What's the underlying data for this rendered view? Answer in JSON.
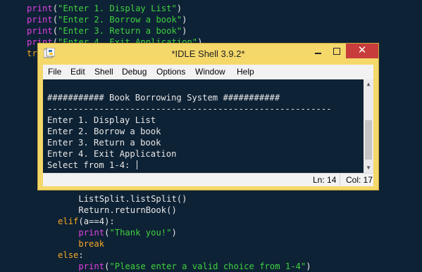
{
  "editor": {
    "top_lines": [
      {
        "parts": [
          {
            "t": "print",
            "c": "kw-print"
          },
          {
            "t": "(",
            "c": "plain"
          },
          {
            "t": "\"Enter 1. Display List\"",
            "c": "str"
          },
          {
            "t": ")",
            "c": "plain"
          }
        ]
      },
      {
        "parts": [
          {
            "t": "print",
            "c": "kw-print"
          },
          {
            "t": "(",
            "c": "plain"
          },
          {
            "t": "\"Enter 2. Borrow a book\"",
            "c": "str"
          },
          {
            "t": ")",
            "c": "plain"
          }
        ]
      },
      {
        "parts": [
          {
            "t": "print",
            "c": "kw-print"
          },
          {
            "t": "(",
            "c": "plain"
          },
          {
            "t": "\"Enter 3. Return a book\"",
            "c": "str"
          },
          {
            "t": ")",
            "c": "plain"
          }
        ]
      },
      {
        "parts": [
          {
            "t": "print",
            "c": "kw-print"
          },
          {
            "t": "(",
            "c": "plain"
          },
          {
            "t": "\"Enter 4. Exit Application\"",
            "c": "str"
          },
          {
            "t": ")",
            "c": "plain"
          }
        ]
      },
      {
        "parts": [
          {
            "t": "tr",
            "c": "kw-ctl"
          }
        ]
      }
    ],
    "bottom_lines": [
      {
        "indent": "          ",
        "parts": [
          {
            "t": "ListSplit.listSplit()",
            "c": "plain"
          }
        ]
      },
      {
        "indent": "          ",
        "parts": [
          {
            "t": "Return.returnBook()",
            "c": "plain"
          }
        ]
      },
      {
        "indent": "      ",
        "parts": [
          {
            "t": "elif",
            "c": "kw-ctl"
          },
          {
            "t": "(a==4):",
            "c": "plain"
          }
        ]
      },
      {
        "indent": "          ",
        "parts": [
          {
            "t": "print",
            "c": "kw-print"
          },
          {
            "t": "(",
            "c": "plain"
          },
          {
            "t": "\"Thank you!\"",
            "c": "str"
          },
          {
            "t": ")",
            "c": "plain"
          }
        ]
      },
      {
        "indent": "          ",
        "parts": [
          {
            "t": "break",
            "c": "kw-ctl"
          }
        ]
      },
      {
        "indent": "      ",
        "parts": [
          {
            "t": "else",
            "c": "kw-ctl"
          },
          {
            "t": ":",
            "c": "plain"
          }
        ]
      },
      {
        "indent": "          ",
        "parts": [
          {
            "t": "print",
            "c": "kw-print"
          },
          {
            "t": "(",
            "c": "plain"
          },
          {
            "t": "\"Please enter a valid choice from 1-4\"",
            "c": "str"
          },
          {
            "t": ")",
            "c": "plain"
          }
        ]
      }
    ]
  },
  "window": {
    "title": "*IDLE Shell 3.9.2*",
    "close_glyph": "✕"
  },
  "menu": [
    "File",
    "Edit",
    "Shell",
    "Debug",
    "Options",
    "Window",
    "Help"
  ],
  "shell": {
    "lines": [
      "########### Book Borrowing System ###########",
      "-------------------------------------------------------",
      "Enter 1. Display List",
      "Enter 2. Borrow a book",
      "Enter 3. Return a book",
      "Enter 4. Exit Application"
    ],
    "prompt": "Select from 1-4: "
  },
  "status": {
    "ln": "Ln: 14",
    "col": "Col: 17"
  },
  "colors": {
    "editor_bg": "#0e2235",
    "title_bar": "#f4d86a",
    "close_button": "#c83c3c",
    "string": "#3ed13e",
    "builtin": "#e040e0",
    "keyword": "#f5a623"
  }
}
